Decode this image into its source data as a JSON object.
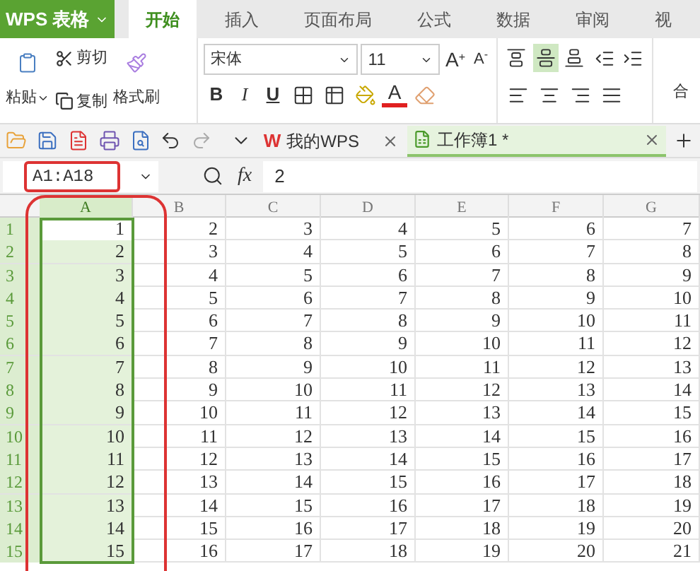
{
  "app_menu": {
    "label": "WPS 表格"
  },
  "ribbon_tabs": [
    {
      "label": "开始",
      "selected": true
    },
    {
      "label": "插入",
      "selected": false
    },
    {
      "label": "页面布局",
      "selected": false
    },
    {
      "label": "公式",
      "selected": false
    },
    {
      "label": "数据",
      "selected": false
    },
    {
      "label": "审阅",
      "selected": false
    },
    {
      "label": "视",
      "selected": false
    }
  ],
  "clipboard": {
    "cut": "剪切",
    "paste": "粘贴",
    "copy": "复制",
    "format_painter": "格式刷"
  },
  "font": {
    "name": "宋体",
    "size": "11",
    "grow": "A",
    "grow_mark": "+",
    "shrink": "A",
    "shrink_mark": "-",
    "bold": "B",
    "italic": "I",
    "underline": "U",
    "font_color": "A"
  },
  "vertical_align": [
    {
      "selected": false
    },
    {
      "selected": true
    },
    {
      "selected": false
    }
  ],
  "merge_label": "合",
  "doc_tabs": [
    {
      "label": "我的WPS",
      "logo": "W",
      "selected": false
    },
    {
      "label": "工作簿1 *",
      "selected": true
    }
  ],
  "formula_bar": {
    "name_box": "A1:A18",
    "fx": "fx",
    "formula": "2"
  },
  "sheet": {
    "columns": [
      {
        "label": "A",
        "selected": true
      },
      {
        "label": "B",
        "selected": false
      },
      {
        "label": "C",
        "selected": false
      },
      {
        "label": "D",
        "selected": false
      },
      {
        "label": "E",
        "selected": false
      },
      {
        "label": "F",
        "selected": false
      },
      {
        "label": "G",
        "selected": false
      }
    ],
    "rows": [
      {
        "header": "1",
        "selected": true,
        "active": true,
        "cells": [
          "1",
          "2",
          "3",
          "4",
          "5",
          "6",
          "7"
        ]
      },
      {
        "header": "2",
        "selected": true,
        "active": false,
        "cells": [
          "2",
          "3",
          "4",
          "5",
          "6",
          "7",
          "8"
        ]
      },
      {
        "header": "3",
        "selected": true,
        "active": false,
        "cells": [
          "3",
          "4",
          "5",
          "6",
          "7",
          "8",
          "9"
        ]
      },
      {
        "header": "4",
        "selected": true,
        "active": false,
        "cells": [
          "4",
          "5",
          "6",
          "7",
          "8",
          "9",
          "10"
        ]
      },
      {
        "header": "5",
        "selected": true,
        "active": false,
        "cells": [
          "5",
          "6",
          "7",
          "8",
          "9",
          "10",
          "11"
        ]
      },
      {
        "header": "6",
        "selected": true,
        "active": false,
        "cells": [
          "6",
          "7",
          "8",
          "9",
          "10",
          "11",
          "12"
        ]
      },
      {
        "header": "7",
        "selected": true,
        "active": false,
        "cells": [
          "7",
          "8",
          "9",
          "10",
          "11",
          "12",
          "13"
        ]
      },
      {
        "header": "8",
        "selected": true,
        "active": false,
        "cells": [
          "8",
          "9",
          "10",
          "11",
          "12",
          "13",
          "14"
        ]
      },
      {
        "header": "9",
        "selected": true,
        "active": false,
        "cells": [
          "9",
          "10",
          "11",
          "12",
          "13",
          "14",
          "15"
        ]
      },
      {
        "header": "10",
        "selected": true,
        "active": false,
        "cells": [
          "10",
          "11",
          "12",
          "13",
          "14",
          "15",
          "16"
        ]
      },
      {
        "header": "11",
        "selected": true,
        "active": false,
        "cells": [
          "11",
          "12",
          "13",
          "14",
          "15",
          "16",
          "17"
        ]
      },
      {
        "header": "12",
        "selected": true,
        "active": false,
        "cells": [
          "12",
          "13",
          "14",
          "15",
          "16",
          "17",
          "18"
        ]
      },
      {
        "header": "13",
        "selected": true,
        "active": false,
        "cells": [
          "13",
          "14",
          "15",
          "16",
          "17",
          "18",
          "19"
        ]
      },
      {
        "header": "14",
        "selected": true,
        "active": false,
        "cells": [
          "14",
          "15",
          "16",
          "17",
          "18",
          "19",
          "20"
        ]
      },
      {
        "header": "15",
        "selected": true,
        "active": false,
        "cells": [
          "15",
          "16",
          "17",
          "18",
          "19",
          "20",
          "21"
        ]
      }
    ]
  }
}
